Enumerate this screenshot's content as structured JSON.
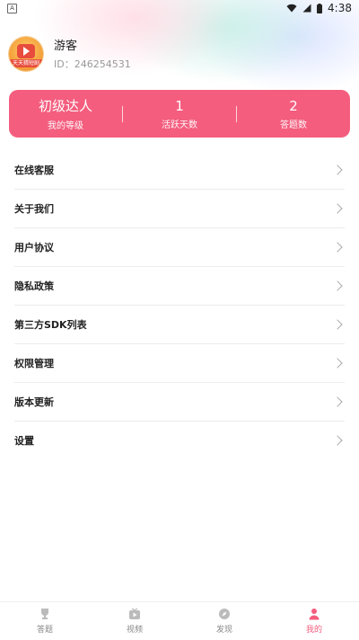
{
  "status_bar": {
    "time": "4:38",
    "notif": "A"
  },
  "profile": {
    "name": "游客",
    "id": "ID：246254531",
    "avatar_text": "天天猜短剧"
  },
  "stats": [
    {
      "value": "初级达人",
      "label": "我的等级"
    },
    {
      "value": "1",
      "label": "活跃天数"
    },
    {
      "value": "2",
      "label": "答题数"
    }
  ],
  "menu": [
    {
      "label": "在线客服"
    },
    {
      "label": "关于我们"
    },
    {
      "label": "用户协议"
    },
    {
      "label": "隐私政策"
    },
    {
      "label": "第三方SDK列表"
    },
    {
      "label": "权限管理"
    },
    {
      "label": "版本更新"
    },
    {
      "label": "设置"
    }
  ],
  "tabs": [
    {
      "label": "答题",
      "icon": "trophy-icon",
      "active": false
    },
    {
      "label": "视频",
      "icon": "video-icon",
      "active": false
    },
    {
      "label": "发现",
      "icon": "compass-icon",
      "active": false
    },
    {
      "label": "我的",
      "icon": "person-icon",
      "active": true
    }
  ],
  "colors": {
    "accent": "#f45d7e",
    "inactive": "#888888"
  }
}
